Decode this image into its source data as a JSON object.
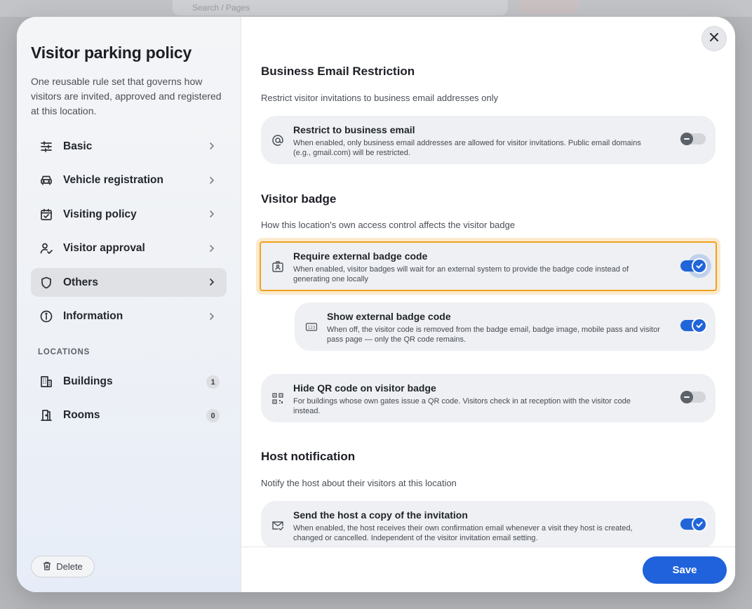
{
  "background": {
    "search_placeholder": "Search / Pages"
  },
  "sidebar": {
    "title": "Visitor parking policy",
    "description": "One reusable rule set that governs how visitors are invited, approved and registered at this location.",
    "nav": [
      {
        "label": "Basic",
        "icon": "sliders-icon",
        "active": false
      },
      {
        "label": "Vehicle registration",
        "icon": "car-icon",
        "active": false
      },
      {
        "label": "Visiting policy",
        "icon": "calendar-check-icon",
        "active": false
      },
      {
        "label": "Visitor approval",
        "icon": "user-check-icon",
        "active": false
      },
      {
        "label": "Others",
        "icon": "shield-icon",
        "active": true
      },
      {
        "label": "Information",
        "icon": "info-icon",
        "active": false
      }
    ],
    "locations_heading": "LOCATIONS",
    "locations": [
      {
        "label": "Buildings",
        "count": "1",
        "icon": "building-icon"
      },
      {
        "label": "Rooms",
        "count": "0",
        "icon": "door-icon"
      }
    ],
    "delete_label": "Delete"
  },
  "content": {
    "sections": [
      {
        "title": "Business Email Restriction",
        "description": "Restrict visitor invitations to business email addresses only",
        "cards": [
          {
            "title": "Restrict to business email",
            "description": "When enabled, only business email addresses are allowed for visitor invitations. Public email domains (e.g., gmail.com) will be restricted.",
            "icon": "at-sign-icon",
            "enabled": false
          }
        ]
      },
      {
        "title": "Visitor badge",
        "description": "How this location's own access control affects the visitor badge",
        "cards": [
          {
            "title": "Require external badge code",
            "description": "When enabled, visitor badges will wait for an external system to provide the badge code instead of generating one locally",
            "icon": "badge-icon",
            "enabled": true,
            "highlighted": true
          },
          {
            "title": "Show external badge code",
            "description": "When off, the visitor code is removed from the badge email, badge image, mobile pass and visitor pass page — only the QR code remains.",
            "icon": "number-123-icon",
            "enabled": true,
            "nested": true
          },
          {
            "title": "Hide QR code on visitor badge",
            "description": "For buildings whose own gates issue a QR code. Visitors check in at reception with the visitor code instead.",
            "icon": "qr-code-icon",
            "enabled": false
          }
        ]
      },
      {
        "title": "Host notification",
        "description": "Notify the host about their visitors at this location",
        "cards": [
          {
            "title": "Send the host a copy of the invitation",
            "description": "When enabled, the host receives their own confirmation email whenever a visit they host is created, changed or cancelled. Independent of the visitor invitation email setting.",
            "icon": "mail-check-icon",
            "enabled": true
          }
        ]
      }
    ]
  },
  "footer": {
    "save_label": "Save"
  },
  "colors": {
    "accent": "#1f62dc",
    "highlight_border": "#f0a11d",
    "card_bg": "#eef0f3"
  }
}
